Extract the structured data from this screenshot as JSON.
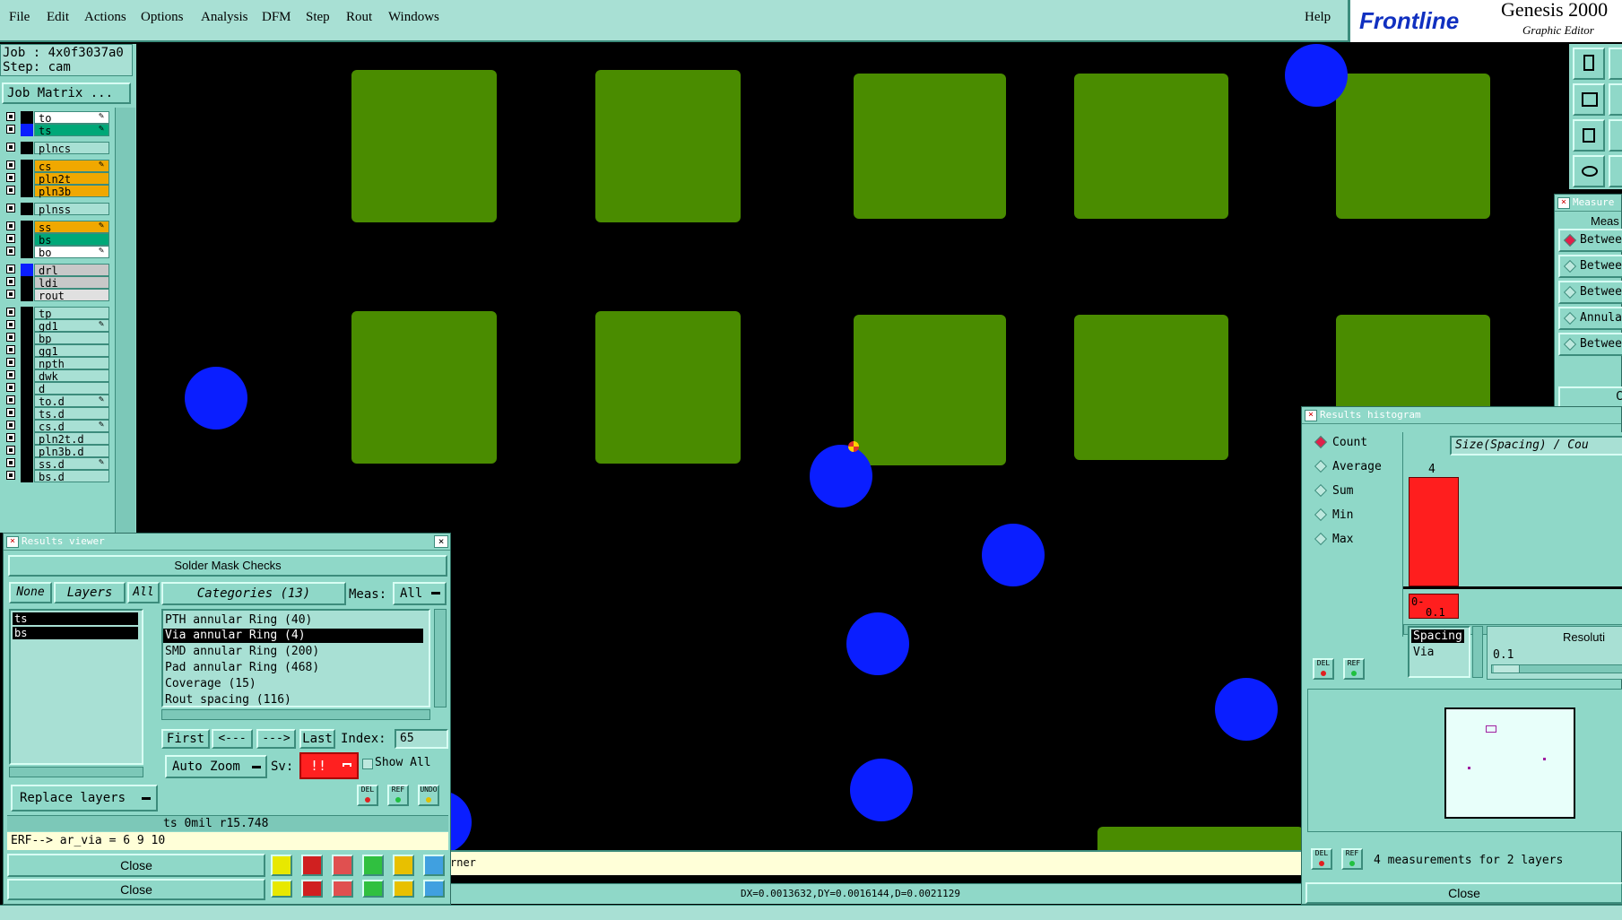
{
  "menubar": {
    "items": [
      "File",
      "Edit",
      "Actions",
      "Options",
      "Analysis",
      "DFM",
      "Step",
      "Rout",
      "Windows"
    ],
    "help": "Help",
    "brand": "Frontline",
    "product": "Genesis 2000",
    "product_sub": "Graphic Editor"
  },
  "left_panel": {
    "job": "Job : 4x0f3037a0",
    "step": "Step: cam",
    "job_matrix_button": "Job Matrix ...",
    "layers": [
      {
        "name": "to",
        "color": "#ffffff",
        "swatch": "#000000",
        "affected": true
      },
      {
        "name": "ts",
        "color": "#00a878",
        "swatch": "#0a1eff",
        "affected": true
      },
      {
        "name": "plncs",
        "color": "#a8e0d4",
        "swatch": "#000000",
        "affected": false
      },
      {
        "name": "cs",
        "color": "#f0a800",
        "swatch": "#000000",
        "affected": true
      },
      {
        "name": "pln2t",
        "color": "#f0a800",
        "swatch": "#000000",
        "affected": false
      },
      {
        "name": "pln3b",
        "color": "#f0a800",
        "swatch": "#000000",
        "affected": false
      },
      {
        "name": "plnss",
        "color": "#a8e0d4",
        "swatch": "#000000",
        "affected": false
      },
      {
        "name": "ss",
        "color": "#f0a800",
        "swatch": "#000000",
        "affected": true
      },
      {
        "name": "bs",
        "color": "#00a878",
        "swatch": "#000000",
        "affected": false
      },
      {
        "name": "bo",
        "color": "#ffffff",
        "swatch": "#000000",
        "affected": true
      },
      {
        "name": "drl",
        "color": "#c8c8c8",
        "swatch": "#0a1eff",
        "affected": false
      },
      {
        "name": "ldi",
        "color": "#c8c8c8",
        "swatch": "#000000",
        "affected": false
      },
      {
        "name": "rout",
        "color": "#e0e0e0",
        "swatch": "#000000",
        "affected": false
      },
      {
        "name": "tp",
        "color": "#a8e0d4",
        "swatch": "#000000",
        "affected": false
      },
      {
        "name": "gd1",
        "color": "#a8e0d4",
        "swatch": "#000000",
        "affected": true
      },
      {
        "name": "bp",
        "color": "#a8e0d4",
        "swatch": "#000000",
        "affected": false
      },
      {
        "name": "gg1",
        "color": "#a8e0d4",
        "swatch": "#000000",
        "affected": false
      },
      {
        "name": "npth",
        "color": "#a8e0d4",
        "swatch": "#000000",
        "affected": false
      },
      {
        "name": "dwk",
        "color": "#a8e0d4",
        "swatch": "#000000",
        "affected": false
      },
      {
        "name": "d",
        "color": "#a8e0d4",
        "swatch": "#000000",
        "affected": false
      },
      {
        "name": "to.d",
        "color": "#a8e0d4",
        "swatch": "#000000",
        "affected": true
      },
      {
        "name": "ts.d",
        "color": "#a8e0d4",
        "swatch": "#000000",
        "affected": false
      },
      {
        "name": "cs.d",
        "color": "#a8e0d4",
        "swatch": "#000000",
        "affected": true
      },
      {
        "name": "pln2t.d",
        "color": "#a8e0d4",
        "swatch": "#000000",
        "affected": false
      },
      {
        "name": "pln3b.d",
        "color": "#a8e0d4",
        "swatch": "#000000",
        "affected": false
      },
      {
        "name": "ss.d",
        "color": "#a8e0d4",
        "swatch": "#000000",
        "affected": true
      },
      {
        "name": "bs.d",
        "color": "#a8e0d4",
        "swatch": "#000000",
        "affected": false
      }
    ]
  },
  "results_viewer": {
    "title": "Results viewer",
    "header": "Solder Mask Checks",
    "none_btn": "None",
    "layers_btn": "Layers",
    "all_btn": "All",
    "layer_list": [
      "ts",
      "bs"
    ],
    "categories_btn": "Categories (13)",
    "meas_label": "Meas:",
    "meas_value": "All",
    "categories": [
      "PTH annular Ring (40)",
      "Via annular Ring (4)",
      "SMD annular Ring (200)",
      "Pad annular Ring (468)",
      "Coverage (15)",
      "Rout spacing (116)"
    ],
    "first": "First",
    "prev": "<---",
    "next": "--->",
    "last": "Last",
    "index_label": "Index:",
    "index_value": "65",
    "auto_zoom": "Auto Zoom",
    "sv_label": "Sv:",
    "sv_value": "!!",
    "show_all": "Show All",
    "replace_layers": "Replace layers",
    "del": "DEL",
    "ref": "REF",
    "undo": "UNDO",
    "status": "ts 0mil  r15.748",
    "erf": "ERF--> ar_via = 6 9 10",
    "close": "Close",
    "close2": "Close"
  },
  "statusbar": {
    "message_fragment": "rner",
    "coords": "DX=0.0013632,DY=0.0016144,D=0.0021129"
  },
  "measure_window": {
    "title": "Measure",
    "header": "Meas",
    "options": [
      "Betwee",
      "Betwee",
      "Betwee",
      "Annula",
      "Betwee"
    ],
    "selected": 0,
    "button_fragment": "C"
  },
  "histogram": {
    "title": "Results histogram",
    "modes": [
      "Count",
      "Average",
      "Sum",
      "Min",
      "Max"
    ],
    "selected_mode": 0,
    "chart_title": "Size(Spacing) / Cou",
    "bar_value": "4",
    "bar_range_top": "0-",
    "bar_range_bottom": "0.1",
    "list": [
      "Spacing",
      "Via"
    ],
    "resolution_label": "Resoluti",
    "resolution_value": "0.1",
    "summary": "4 measurements for 2 layers",
    "close": "Close",
    "accent": "#ff1e1e"
  },
  "colors": {
    "pad": "#4a8c00",
    "via": "#0a1eff",
    "panel": "#8fd8c8"
  }
}
